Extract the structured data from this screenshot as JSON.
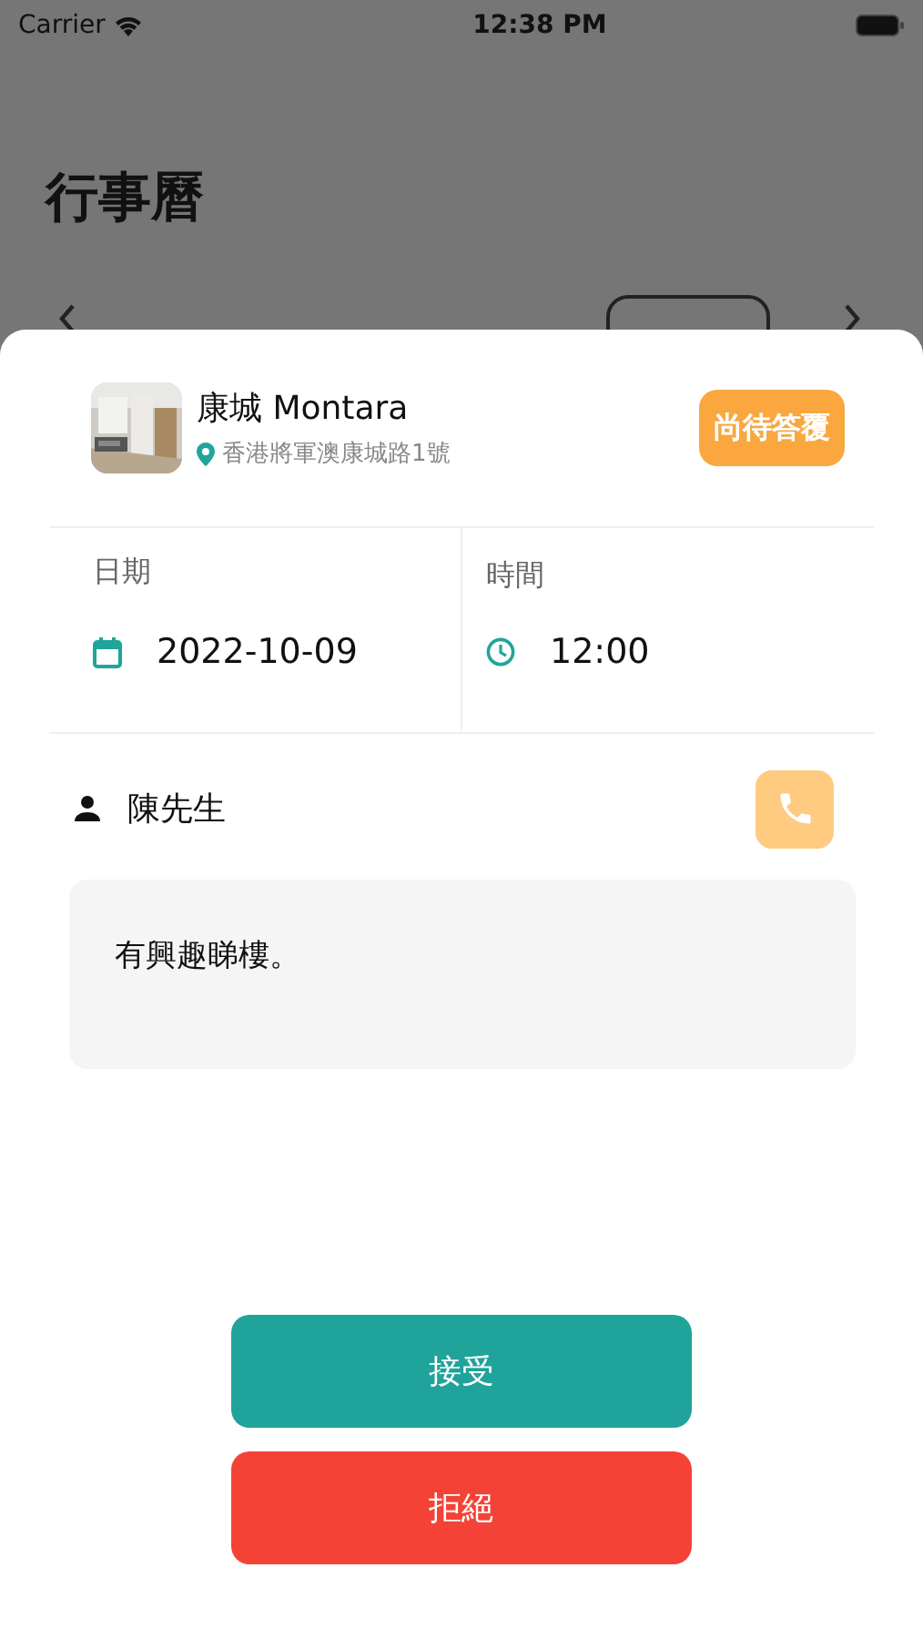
{
  "status_bar": {
    "carrier": "Carrier",
    "time": "12:38 PM"
  },
  "page_title": "行事曆",
  "appointment": {
    "property_name": "康城 Montara",
    "address": "香港將軍澳康城路1號",
    "status": "尚待答覆",
    "date_label": "日期",
    "date": "2022-10-09",
    "time_label": "時間",
    "time": "12:00",
    "contact_name": "陳先生",
    "note": "有興趣睇樓。"
  },
  "actions": [
    {
      "label": "接受",
      "kind": "accept"
    },
    {
      "label": "拒絕",
      "kind": "reject"
    }
  ]
}
